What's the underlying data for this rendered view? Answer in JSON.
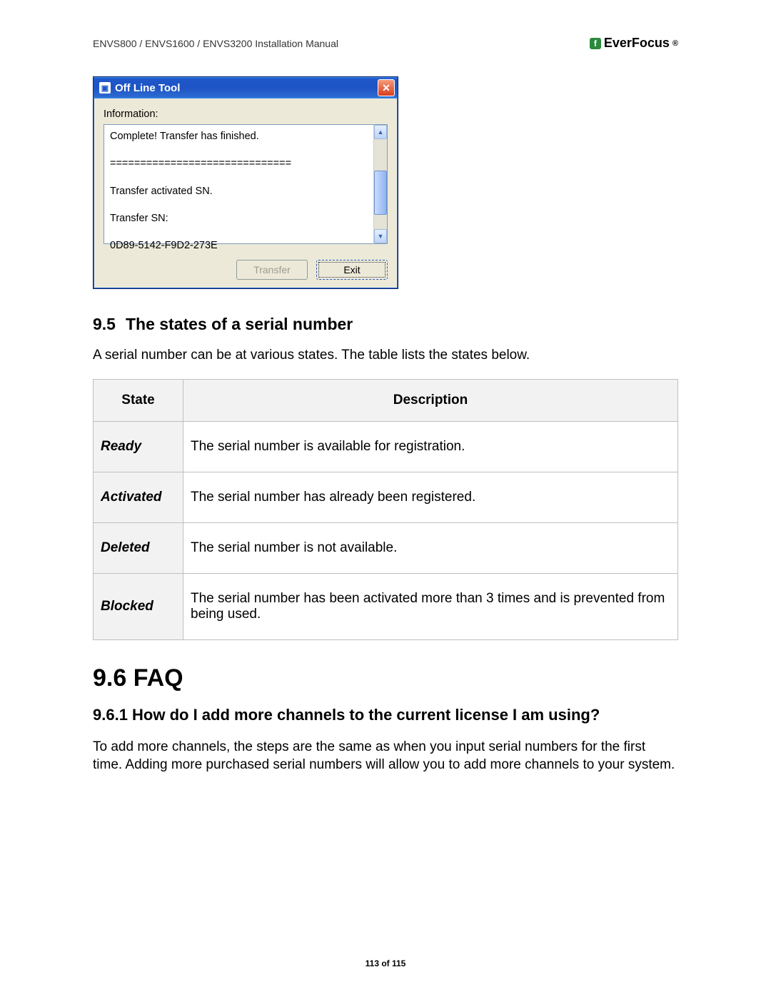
{
  "header": {
    "doc_title": "ENVS800 / ENVS1600 / ENVS3200 Installation Manual",
    "brand": "EverFocus"
  },
  "xp_window": {
    "title": "Off Line Tool",
    "info_label": "Information:",
    "lines": [
      "Complete! Transfer has finished.",
      "==============================",
      "Transfer activated SN.",
      "Transfer SN:",
      "0D89-5142-F9D2-273E"
    ],
    "btn_transfer": "Transfer",
    "btn_exit": "Exit"
  },
  "section_95": {
    "number": "9.5",
    "title": "The states of a serial number",
    "intro": "A serial number can be at various states. The table lists the states below.",
    "table": {
      "head_state": "State",
      "head_desc": "Description",
      "rows": [
        {
          "state": "Ready",
          "desc": "The serial number is available for registration."
        },
        {
          "state": "Activated",
          "desc": "The serial number has already been registered."
        },
        {
          "state": "Deleted",
          "desc": "The serial number is not available."
        },
        {
          "state": "Blocked",
          "desc": "The serial number has been activated more than 3 times and is prevented from being used."
        }
      ]
    }
  },
  "section_96": {
    "heading": "9.6  FAQ",
    "sub_heading": "9.6.1 How do I add more channels to the current license I am using?",
    "body": "To add more channels, the steps are the same as when you input serial numbers for the first time. Adding more purchased serial numbers will allow you to add more channels to your system."
  },
  "footer": {
    "page": "113 of 115"
  }
}
